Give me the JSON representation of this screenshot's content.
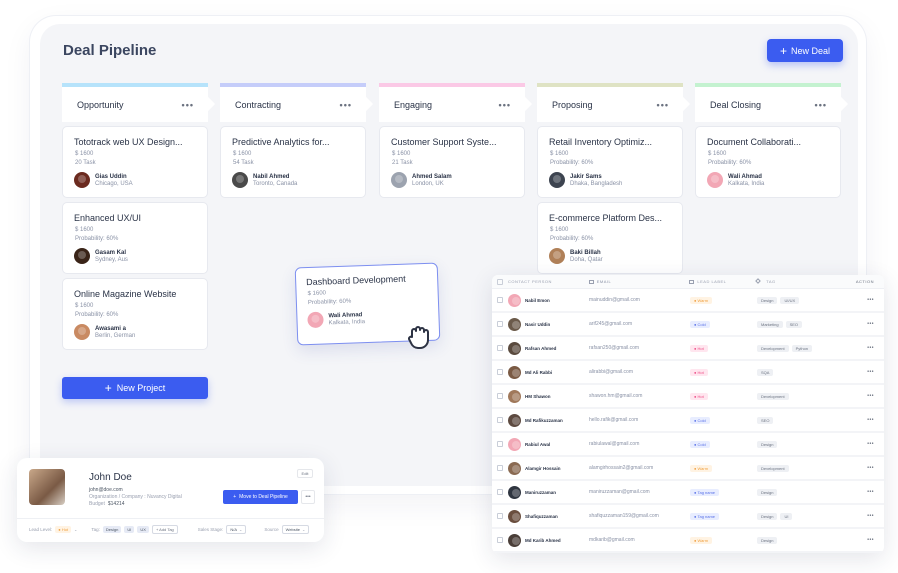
{
  "board": {
    "title": "Deal Pipeline",
    "new_deal_label": "New Deal",
    "new_project_label": "New Project",
    "columns": [
      {
        "label": "Opportunity",
        "accent": "#b6e3fb",
        "cards": [
          {
            "title": "Tototrack web UX Design...",
            "amount": "$ 1600",
            "meta": "20 Task",
            "person": "Gias Uddin",
            "location": "Chicago, USA",
            "avatar_color": "#6b2a1f"
          },
          {
            "title": "Enhanced UX/UI",
            "amount": "$ 1600",
            "meta": "Probability: 60%",
            "person": "Gasam Kal",
            "location": "Sydney, Aus",
            "avatar_color": "#3a2418"
          },
          {
            "title": "Online Magazine Website",
            "amount": "$ 1600",
            "meta": "Probability: 60%",
            "person": "Awasami a",
            "location": "Berlin, German",
            "avatar_color": "#c98a62"
          }
        ]
      },
      {
        "label": "Contracting",
        "accent": "#c5cdfa",
        "cards": [
          {
            "title": "Predictive Analytics for...",
            "amount": "$ 1600",
            "meta": "54 Task",
            "person": "Nabil Ahmed",
            "location": "Toronto, Canada",
            "avatar_color": "#4a4a4a"
          }
        ]
      },
      {
        "label": "Engaging",
        "accent": "#fbc9e6",
        "cards": [
          {
            "title": "Customer Support Syste...",
            "amount": "$ 1600",
            "meta": "21 Task",
            "person": "Ahmed Salam",
            "location": "London, UK",
            "avatar_color": "#9ca3af"
          }
        ]
      },
      {
        "label": "Proposing",
        "accent": "#dfe3c4",
        "cards": [
          {
            "title": "Retail Inventory Optimiz...",
            "amount": "$ 1600",
            "meta": "Probability: 60%",
            "person": "Jakir Sams",
            "location": "Dhaka, Bangladesh",
            "avatar_color": "#3d4450"
          },
          {
            "title": "E-commerce Platform Des...",
            "amount": "$ 1600",
            "meta": "Probability: 60%",
            "person": "Baki Billah",
            "location": "Doha, Qatar",
            "avatar_color": "#b08058"
          }
        ]
      },
      {
        "label": "Deal Closing",
        "accent": "#c4f2d0",
        "cards": [
          {
            "title": "Document Collaborati...",
            "amount": "$ 1600",
            "meta": "Probability: 60%",
            "person": "Wali Ahmad",
            "location": "Kalkata, India",
            "avatar_color": "#f2a7b5"
          }
        ]
      }
    ],
    "dragged_card": {
      "title": "Dashboard Development",
      "amount": "$ 1600",
      "meta": "Probability: 60%",
      "person": "Wali Ahmad",
      "location": "Kalkata, India",
      "avatar_color": "#f2a7b5"
    }
  },
  "contacts": {
    "headers": {
      "person": "CONTACT PERSON",
      "email": "EMAIL",
      "lead": "LEAD LABEL",
      "tag": "TAG",
      "action": "ACTION"
    },
    "rows": [
      {
        "name": "Nabil Emon",
        "email": "mainuddin@gmail.com",
        "lead": "Warm",
        "lead_type": "warm",
        "tags": [
          "Design",
          "UI/UX"
        ],
        "avatar_color": "#f2a7b5"
      },
      {
        "name": "Nasir Uddin",
        "email": "arif245@gmail.com",
        "lead": "Cold",
        "lead_type": "cold",
        "tags": [
          "Marketing",
          "SEO"
        ],
        "avatar_color": "#6b5a4a"
      },
      {
        "name": "Rafsan Ahmed",
        "email": "rafsan250@gmail.com",
        "lead": "Hot",
        "lead_type": "hot",
        "tags": [
          "Development",
          "Python"
        ],
        "avatar_color": "#5a4a3e"
      },
      {
        "name": "Md Ali Rabbi",
        "email": "alirabbi@gmail.com",
        "lead": "Hot",
        "lead_type": "hot",
        "tags": [
          "SQA"
        ],
        "avatar_color": "#7a5a44"
      },
      {
        "name": "HM Shawon",
        "email": "shawon.hm@gmail.com",
        "lead": "Hot",
        "lead_type": "hot",
        "tags": [
          "Development"
        ],
        "avatar_color": "#a0785a"
      },
      {
        "name": "Md Rafikuzzaman",
        "email": "hello.rafik@gmail.com",
        "lead": "Cold",
        "lead_type": "cold",
        "tags": [
          "SEO"
        ],
        "avatar_color": "#5d4a40"
      },
      {
        "name": "Rabiul Awal",
        "email": "rabiulawal@gmail.com",
        "lead": "Cold",
        "lead_type": "cold",
        "tags": [
          "Design"
        ],
        "avatar_color": "#f2a7b5"
      },
      {
        "name": "Alamgir Hossain",
        "email": "alamgirhossain2@gmail.com",
        "lead": "Warm",
        "lead_type": "warm",
        "tags": [
          "Development"
        ],
        "avatar_color": "#8a6a52"
      },
      {
        "name": "Maniruzzaman",
        "email": "maniruzzaman@gmail.com",
        "lead": "Tag name",
        "lead_type": "tag",
        "tags": [
          "Design"
        ],
        "avatar_color": "#2f3540"
      },
      {
        "name": "Shafiquzzaman",
        "email": "shafiquzzaman159@gmail.com",
        "lead": "Tag name",
        "lead_type": "tag",
        "tags": [
          "Design",
          "UI"
        ],
        "avatar_color": "#6a4e3e"
      },
      {
        "name": "Md Karib Ahmed",
        "email": "mdkarib@gmail.com",
        "lead": "Warm",
        "lead_type": "warm",
        "tags": [
          "Design"
        ],
        "avatar_color": "#4a3e38"
      }
    ]
  },
  "profile": {
    "name": "John Doe",
    "email": "john@doe.com",
    "organization": "Organization / Company : Nuvancy Digital",
    "budget_label": "Budget",
    "budget_value": "$14214",
    "edit_label": "Edit",
    "move_label": "Move to Deal Pipeline",
    "lead_level_label": "Lead Level:",
    "lead_level_value": "Hot",
    "tag_label": "Tag:",
    "tags": [
      "Design",
      "UI",
      "UX"
    ],
    "add_tag_label": "+ Add Tag",
    "sales_stage_label": "Sales Stage:",
    "sales_stage_value": "N/A",
    "source_label": "Source",
    "source_value": "Website"
  }
}
